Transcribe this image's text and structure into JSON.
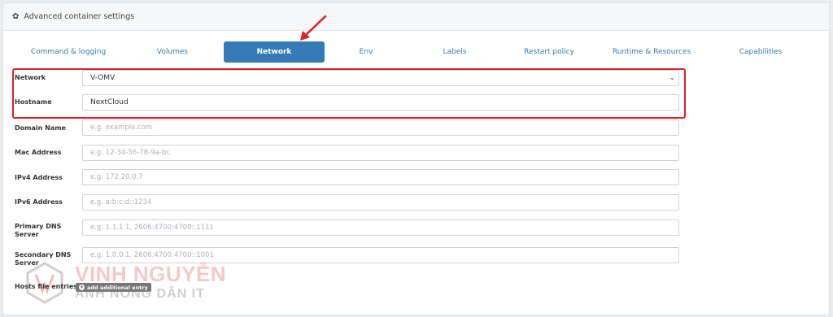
{
  "header": {
    "title": "Advanced container settings",
    "icon": "gear-icon"
  },
  "tabs": [
    {
      "label": "Command & logging"
    },
    {
      "label": "Volumes"
    },
    {
      "label": "Network"
    },
    {
      "label": "Env"
    },
    {
      "label": "Labels"
    },
    {
      "label": "Restart policy"
    },
    {
      "label": "Runtime & Resources"
    },
    {
      "label": "Capabilities"
    }
  ],
  "active_tab": "Network",
  "form": {
    "network": {
      "label": "Network",
      "value": "V-OMV"
    },
    "hostname": {
      "label": "Hostname",
      "value": "NextCloud"
    },
    "domain": {
      "label": "Domain Name",
      "placeholder": "e.g. example.com"
    },
    "mac": {
      "label": "Mac Address",
      "placeholder": "e.g. 12-34-56-78-9a-bc"
    },
    "ipv4": {
      "label": "IPv4 Address",
      "placeholder": "e.g. 172.20.0.7"
    },
    "ipv6": {
      "label": "IPv6 Address",
      "placeholder": "e.g. a:b:c:d::1234"
    },
    "dns1": {
      "label_line1": "Primary DNS",
      "label_line2": "Server",
      "placeholder": "e.g. 1.1.1.1, 2606:4700:4700::1111"
    },
    "dns2": {
      "label_line1": "Secondary DNS",
      "label_line2": "Server",
      "placeholder": "e.g. 1.0.0.1, 2606:4700:4700::1001"
    },
    "hosts": {
      "label": "Hosts file entries",
      "button": "add additional entry"
    }
  },
  "watermark": {
    "line1": "VINH NGUYỄN",
    "line2": "ANH NÔNG DÂN IT"
  },
  "colors": {
    "accent": "#337ab7",
    "highlight": "#e01f26"
  }
}
